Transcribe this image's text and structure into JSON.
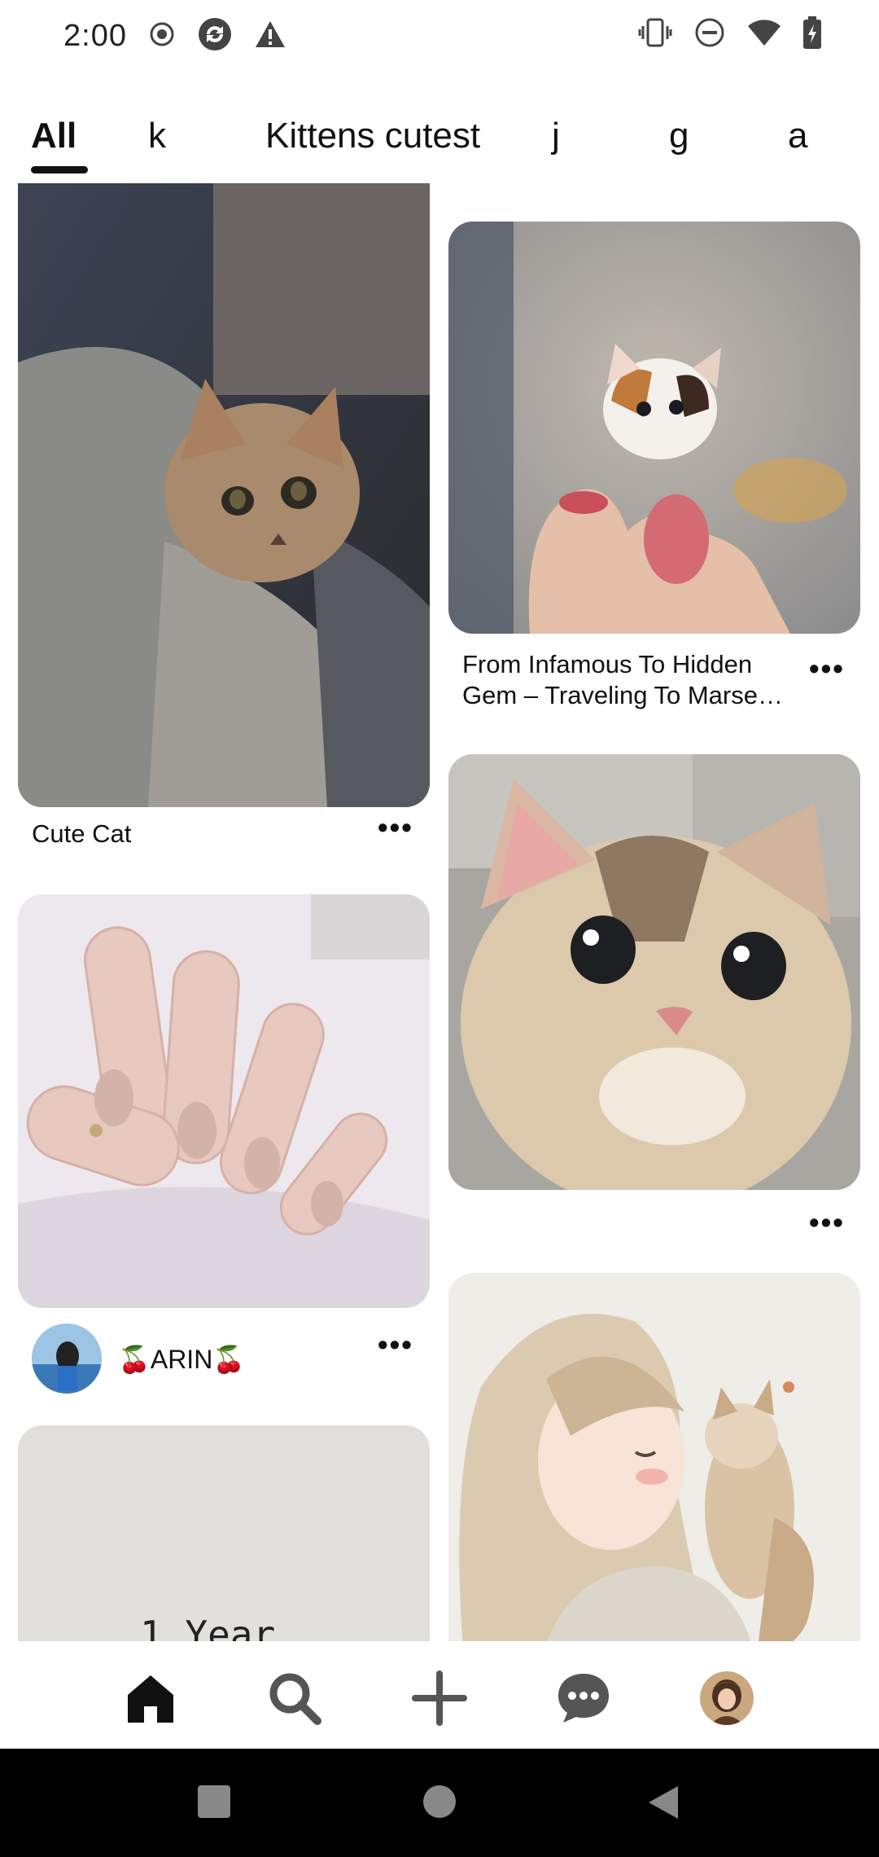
{
  "status_bar": {
    "time": "2:00",
    "left_icons": [
      "record-icon",
      "sync-icon",
      "warning-icon"
    ],
    "right_icons": [
      "vibrate-icon",
      "dnd-icon",
      "wifi-icon",
      "battery-charging-icon"
    ]
  },
  "tabs": [
    {
      "label": "All",
      "active": true
    },
    {
      "label": "k",
      "active": false
    },
    {
      "label": "Kittens cutest",
      "active": false
    },
    {
      "label": "j",
      "active": false
    },
    {
      "label": "g",
      "active": false
    },
    {
      "label": "a",
      "active": false
    }
  ],
  "pins": {
    "cute_cat": {
      "title": "Cute Cat"
    },
    "tiny_kitten": {
      "title_line1": "From Infamous To Hidden",
      "title_line2": "Gem – Traveling To Marse…"
    },
    "nails": {
      "author": "🍒ARIN🍒"
    },
    "big_eyes_cat": {},
    "girl_cat": {},
    "one_year": {
      "text": "1 Year"
    }
  },
  "bottom_nav": [
    "home-icon",
    "search-icon",
    "create-icon",
    "messages-icon",
    "profile-avatar"
  ],
  "colors": {
    "accent": "#111111",
    "background": "#ffffff"
  }
}
